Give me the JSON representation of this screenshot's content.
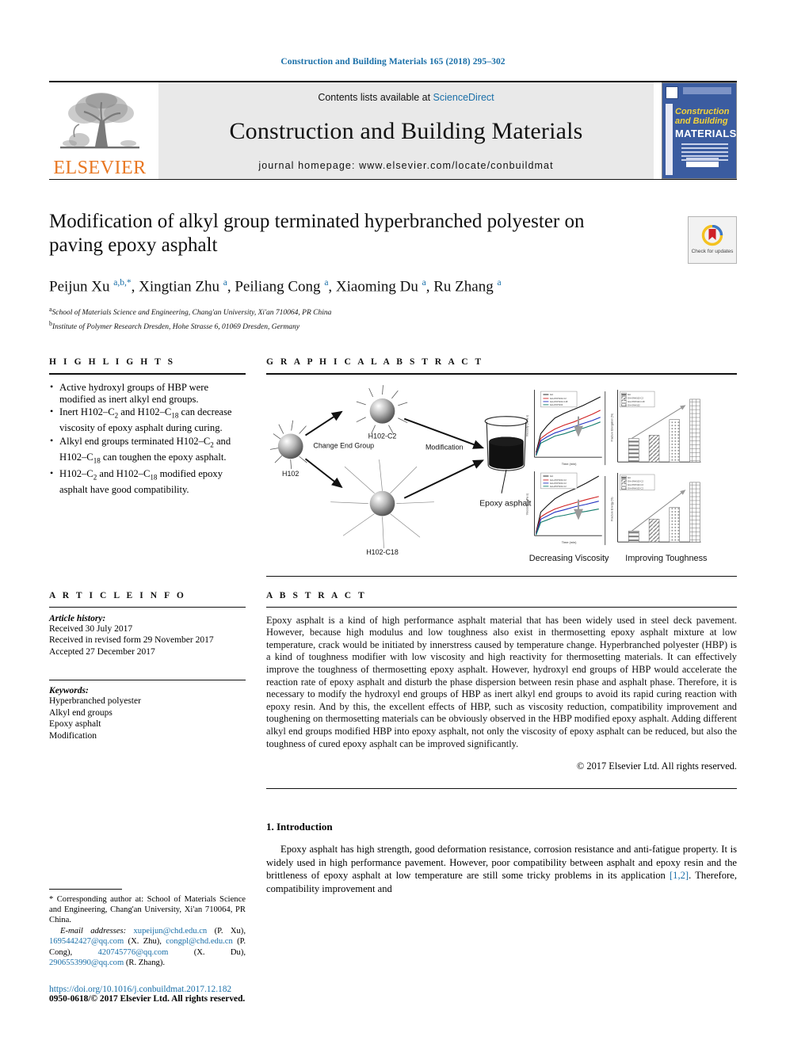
{
  "running_head": "Construction and Building Materials 165 (2018) 295–302",
  "masthead": {
    "contents_prefix": "Contents lists available at ",
    "sciencedirect": "ScienceDirect",
    "journal_title": "Construction and Building Materials",
    "homepage": "journal homepage: www.elsevier.com/locate/conbuildmat",
    "publisher": "ELSEVIER",
    "cover": {
      "line1": "Construction",
      "line2": "and Building",
      "line3": "MATERIALS"
    }
  },
  "article": {
    "title": "Modification of alkyl group terminated hyperbranched polyester on paving epoxy asphalt",
    "authors_html": "Peijun Xu <sup>a,b,</sup><sup>*</sup>, Xingtian Zhu <sup>a</sup>, Peiliang Cong <sup>a</sup>, Xiaoming Du <sup>a</sup>, Ru Zhang <sup>a</sup>",
    "affiliation_a": "School of Materials Science and Engineering, Chang'an University, Xi'an 710064, PR China",
    "affiliation_b": "Institute of Polymer Research Dresden, Hohe Strasse 6, 01069 Dresden, Germany",
    "crossmark_label": "Check for updates"
  },
  "highlights": {
    "heading": "H I G H L I G H T S",
    "items": [
      "Active hydroxyl groups of HBP were modified as inert alkyl end groups.",
      "Inert H102–C<sub>2</sub> and H102–C<sub>18</sub> can decrease viscosity of epoxy asphalt during curing.",
      "Alkyl end groups terminated H102–C<sub>2</sub> and H102–C<sub>18</sub> can toughen the epoxy asphalt.",
      "H102–C<sub>2</sub> and H102–C<sub>18</sub> modified epoxy asphalt have good compatibility."
    ]
  },
  "graphical_abstract": {
    "heading": "G R A P H I C A L   A B S T R A C T",
    "labels": {
      "start_molecule": "H102",
      "branch_top": "H102-C2",
      "branch_bottom": "H102-C18",
      "change_arrow": "Change End Group",
      "modification_arrow": "Modification",
      "beaker": "Epoxy asphalt",
      "caption_left": "Decreasing Viscosity",
      "caption_right": "Improving Toughness"
    }
  },
  "chart_data": [
    {
      "type": "line",
      "title": "",
      "xlabel": "Time (min)",
      "ylabel": "Viscosity (mPa s)",
      "xlim": [
        0,
        150
      ],
      "ylim": [
        0,
        800
      ],
      "xticks": [
        0,
        50,
        100,
        150
      ],
      "yticks": [
        0,
        100,
        200,
        300,
        400,
        500,
        600,
        700,
        800
      ],
      "legend_position": "top-left",
      "series": [
        {
          "name": "EA",
          "color": "#000000",
          "x": [
            0,
            10,
            25,
            50,
            75,
            100,
            125,
            140
          ],
          "values": [
            30,
            160,
            300,
            430,
            530,
            620,
            700,
            760
          ]
        },
        {
          "name": "EA+5%H102-C2",
          "color": "#d02020",
          "x": [
            0,
            10,
            25,
            50,
            75,
            100,
            125,
            140
          ],
          "values": [
            25,
            130,
            220,
            300,
            370,
            440,
            520,
            590
          ]
        },
        {
          "name": "EA+5%H102-C18",
          "color": "#2030c0",
          "x": [
            0,
            10,
            25,
            50,
            75,
            100,
            125,
            140
          ],
          "values": [
            22,
            115,
            195,
            265,
            325,
            385,
            440,
            495
          ]
        },
        {
          "name": "EA+5%H102",
          "color": "#117a6b",
          "x": [
            0,
            10,
            25,
            50,
            75,
            100,
            125,
            140
          ],
          "values": [
            18,
            100,
            165,
            225,
            275,
            325,
            375,
            420
          ]
        }
      ]
    },
    {
      "type": "bar",
      "title": "",
      "xlabel": "",
      "ylabel": "Fracture Elongation (%)",
      "categories": [
        "EA",
        "EA+5%H102-C2",
        "EA+5%H102-C18",
        "EA+5%H102"
      ],
      "values": [
        42,
        48,
        92,
        152
      ],
      "ylim": [
        0,
        160
      ],
      "yticks": [
        0,
        20,
        40,
        60,
        80,
        100,
        120,
        140,
        160
      ],
      "legend_position": "top-left",
      "annotation": "increasing arrow"
    },
    {
      "type": "line",
      "title": "",
      "xlabel": "Time (min)",
      "ylabel": "Viscosity (mPa s)",
      "xlim": [
        0,
        150
      ],
      "ylim": [
        0,
        900
      ],
      "xticks": [
        0,
        50,
        100,
        150
      ],
      "legend_position": "top-left",
      "series": [
        {
          "name": "EA",
          "color": "#000000",
          "x": [
            0,
            10,
            25,
            50,
            75,
            100,
            130
          ],
          "values": [
            40,
            230,
            330,
            480,
            600,
            700,
            850
          ]
        },
        {
          "name": "EA+3%H102-C2",
          "color": "#d02020",
          "x": [
            0,
            10,
            25,
            50,
            75,
            100,
            130
          ],
          "values": [
            35,
            200,
            270,
            340,
            400,
            460,
            540
          ]
        },
        {
          "name": "EA+5%H102-C2",
          "color": "#2030c0",
          "x": [
            0,
            10,
            25,
            50,
            75,
            100,
            130
          ],
          "values": [
            32,
            185,
            250,
            310,
            360,
            410,
            480
          ]
        },
        {
          "name": "EA+8%H102-C2",
          "color": "#117a6b",
          "x": [
            0,
            10,
            25,
            50,
            75,
            100,
            130
          ],
          "values": [
            28,
            165,
            215,
            260,
            295,
            330,
            375
          ]
        }
      ]
    },
    {
      "type": "bar",
      "title": "",
      "xlabel": "",
      "ylabel": "Fracture Energy (%)",
      "categories": [
        "EA",
        "EA+3%H102-C2",
        "EA+5%H102-C2",
        "EA+8%H102-C2"
      ],
      "values": [
        12,
        26,
        40,
        68
      ],
      "ylim": [
        0,
        80
      ],
      "yticks": [
        0,
        10,
        20,
        30,
        40,
        50,
        60,
        70,
        80
      ],
      "legend_position": "top-left",
      "annotation": "increasing arrow"
    }
  ],
  "article_info": {
    "heading": "A R T I C L E   I N F O",
    "history_label": "Article history:",
    "history": [
      "Received 30 July 2017",
      "Received in revised form 29 November 2017",
      "Accepted 27 December 2017"
    ],
    "keywords_label": "Keywords:",
    "keywords": [
      "Hyperbranched polyester",
      "Alkyl end groups",
      "Epoxy asphalt",
      "Modification"
    ]
  },
  "abstract": {
    "heading": "A B S T R A C T",
    "text": "Epoxy asphalt is a kind of high performance asphalt material that has been widely used in steel deck pavement. However, because high modulus and low toughness also exist in thermosetting epoxy asphalt mixture at low temperature, crack would be initiated by innerstress caused by temperature change. Hyperbranched polyester (HBP) is a kind of toughness modifier with low viscosity and high reactivity for thermosetting materials. It can effectively improve the toughness of thermosetting epoxy asphalt. However, hydroxyl end groups of HBP would accelerate the reaction rate of epoxy asphalt and disturb the phase dispersion between resin phase and asphalt phase. Therefore, it is necessary to modify the hydroxyl end groups of HBP as inert alkyl end groups to avoid its rapid curing reaction with epoxy resin. And by this, the excellent effects of HBP, such as viscosity reduction, compatibility improvement and toughening on thermosetting materials can be obviously observed in the HBP modified epoxy asphalt. Adding different alkyl end groups modified HBP into epoxy asphalt, not only the viscosity of epoxy asphalt can be reduced, but also the toughness of cured epoxy asphalt can be improved significantly.",
    "copyright": "© 2017 Elsevier Ltd. All rights reserved."
  },
  "introduction": {
    "heading": "1. Introduction",
    "paragraph_1": "Epoxy asphalt has high strength, good deformation resistance, corrosion resistance and anti-fatigue property. It is widely used in high performance pavement. However, poor compatibility between asphalt and epoxy resin and the brittleness of epoxy asphalt at low temperature are still some tricky problems in its application ",
    "citation": "[1,2]",
    "paragraph_1_cont": ". Therefore, compatibility improvement and"
  },
  "footnote": {
    "corresponding_marker": "*",
    "corresponding_text": " Corresponding author at: School of Materials Science and Engineering, Chang'an University, Xi'an 710064, PR China.",
    "email_label": "E-mail addresses:",
    "emails": [
      {
        "address": "xupeijun@chd.edu.cn",
        "person": "(P. Xu)"
      },
      {
        "address": "1695442427@qq.com",
        "person": "(X. Zhu)"
      },
      {
        "address": "congpl@chd.edu.cn",
        "person": "(P. Cong)"
      },
      {
        "address": "420745776@qq.com",
        "person": "(X. Du)"
      },
      {
        "address": "2906553990@qq.com",
        "person": "(R. Zhang)"
      }
    ]
  },
  "page_footer": {
    "doi": "https://doi.org/10.1016/j.conbuildmat.2017.12.182",
    "issn_line": "0950-0618/© 2017 Elsevier Ltd. All rights reserved."
  },
  "colors": {
    "link": "#1a6fa8",
    "elsevier_orange": "#E87722",
    "cover_blue": "#3b5ca0",
    "cover_yellow": "#f3d23b"
  }
}
